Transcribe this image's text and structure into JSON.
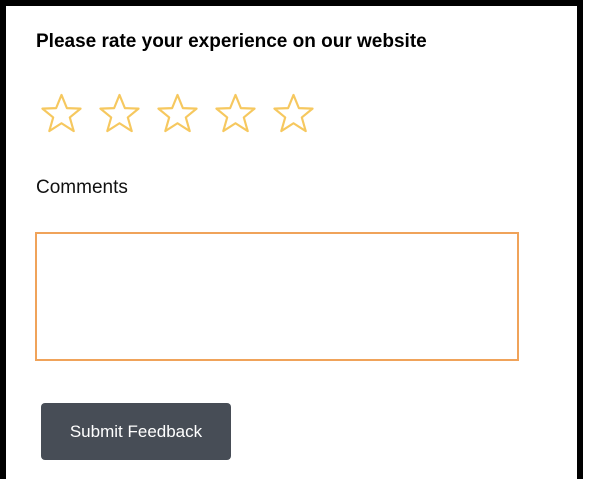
{
  "form": {
    "title": "Please rate your experience on our website",
    "rating": {
      "max": 5,
      "value": 0,
      "star_outline_color": "#f6c85f",
      "icons": [
        "star-icon",
        "star-icon",
        "star-icon",
        "star-icon",
        "star-icon"
      ]
    },
    "comments_label": "Comments",
    "comments_value": "",
    "comments_border_color": "#f0a35a",
    "submit_label": "Submit Feedback",
    "submit_color": "#474d56"
  }
}
